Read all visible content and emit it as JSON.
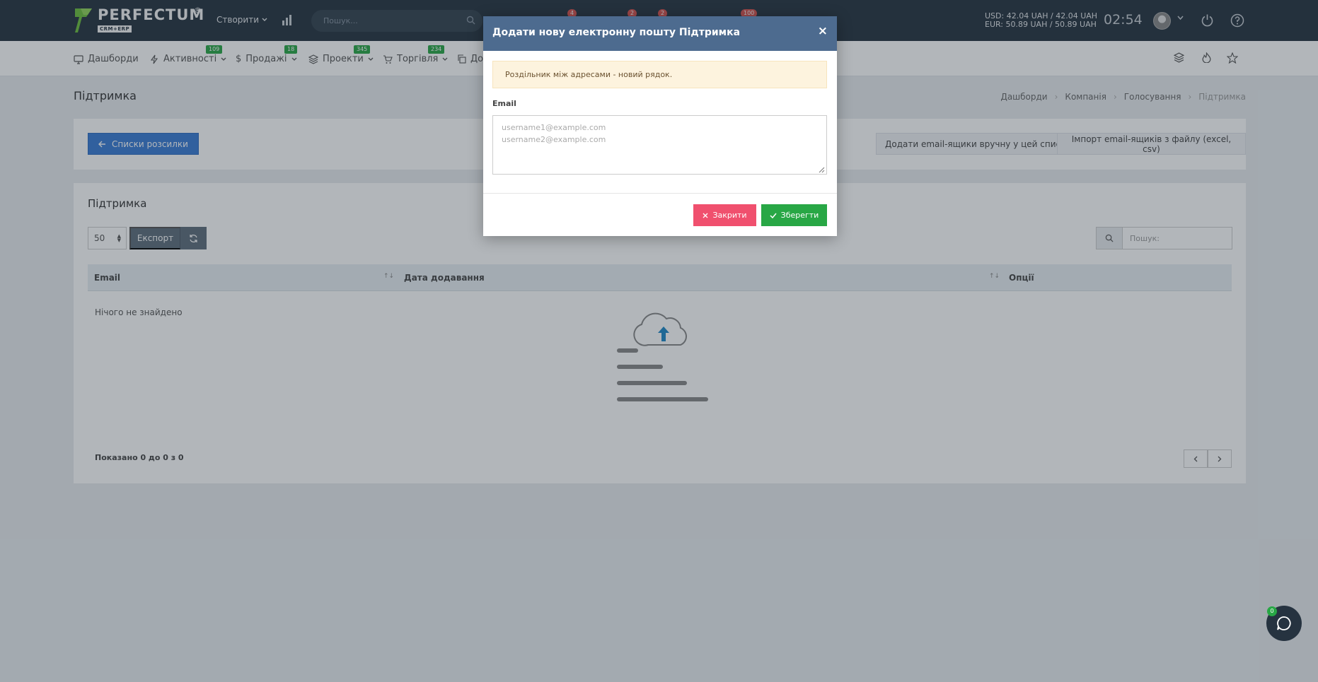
{
  "app": {
    "logo_name": "PERFECTUM",
    "logo_reg": "®",
    "logo_sub": "CRM+ERP"
  },
  "topbar": {
    "create_label": "Створити",
    "search_placeholder": "Пошук...",
    "badges": [
      "4",
      "2",
      "2",
      "100"
    ],
    "currency_usd": "USD: 42.04 UAH / 42.04 UAH",
    "currency_eur": "EUR: 50.89 UAH / 50.89 UAH",
    "time": "02:54"
  },
  "nav": {
    "items": [
      {
        "label": "Дашборди",
        "badge": "",
        "icon": "monitor-icon"
      },
      {
        "label": "Активності",
        "badge": "109",
        "icon": "bolt-icon"
      },
      {
        "label": "Продажі",
        "badge": "18",
        "icon": "dollar-icon"
      },
      {
        "label": "Проекти",
        "badge": "345",
        "icon": "layers-icon"
      },
      {
        "label": "Торгівля",
        "badge": "234",
        "icon": "cart-icon"
      },
      {
        "label": "До",
        "badge": "",
        "icon": "copy-icon"
      }
    ]
  },
  "page": {
    "title": "Підтримка",
    "breadcrumb": [
      "Дашборди",
      "Компанія",
      "Голосування",
      "Підтримка"
    ],
    "back_label": "Списки розсилки",
    "add_manual_label": "Додати email-ящики вручну у цей список",
    "import_label": "Імпорт email-ящиків з файлу (excel, csv)"
  },
  "table_card": {
    "title": "Підтримка",
    "page_size": "50",
    "export_label": "Експорт",
    "search_placeholder": "Пошук:",
    "columns": [
      "Email",
      "Дата додавання",
      "Опції"
    ],
    "empty_text": "Нічого не знайдено",
    "shown_text": "Показано 0 до 0 з 0"
  },
  "modal": {
    "title": "Додати нову електронну пошту Підтримка",
    "close_symbol": "×",
    "alert_text": "Роздільник між адресами - новий рядок.",
    "field_label": "Email",
    "textarea_placeholder": "username1@example.com\nusername2@example.com",
    "close_label": "Закрити",
    "save_label": "Зберегти"
  },
  "chat": {
    "badge": "0"
  },
  "colors": {
    "topbar": "#263340",
    "modal_header": "#4d6b8f",
    "primary": "#3a7bd5",
    "danger": "#f0506e",
    "success": "#28a745",
    "badge_red": "#d9534f",
    "badge_green": "#28a745",
    "upload_arrow": "#1e88c7"
  }
}
